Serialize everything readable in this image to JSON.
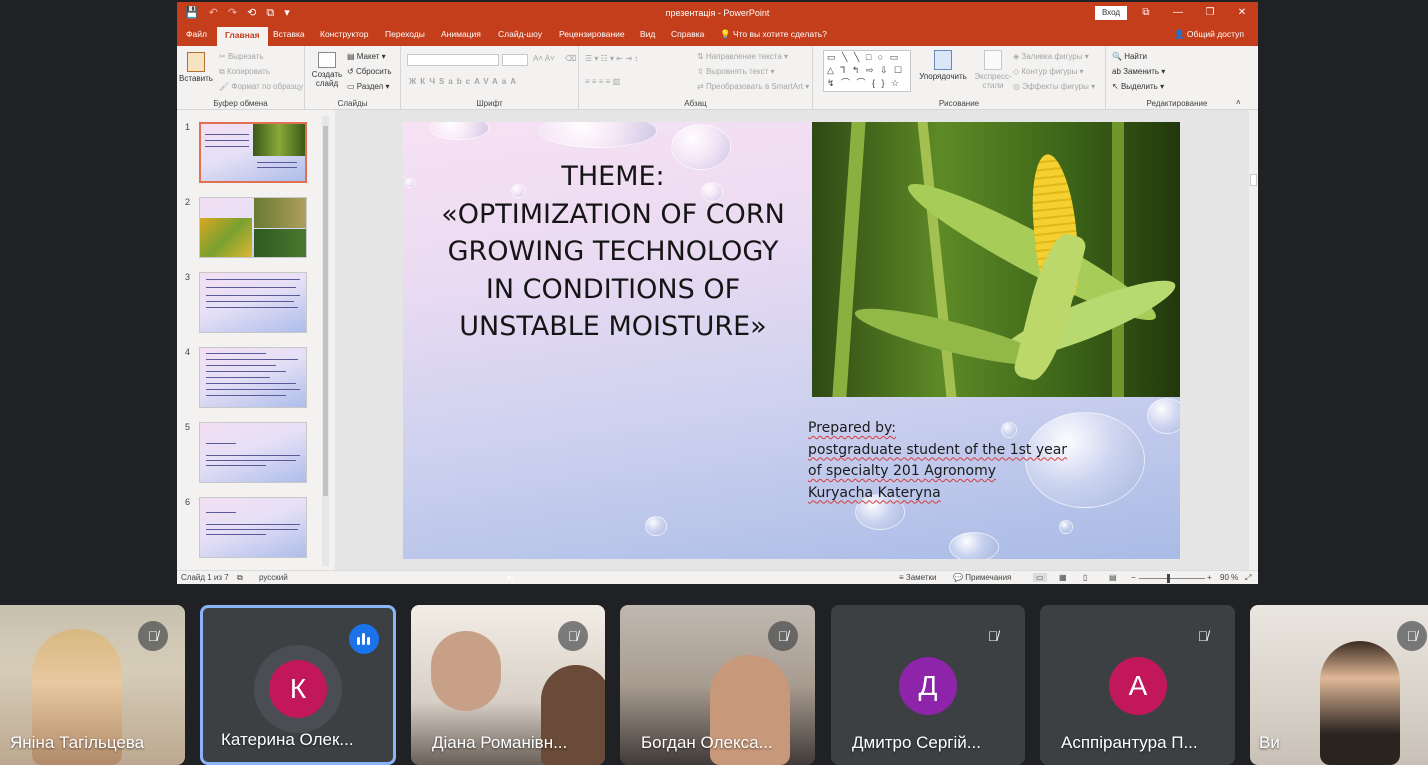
{
  "window": {
    "doc_title": "презентація - PowerPoint",
    "login_label": "Вход",
    "share_label": "Общий доступ",
    "tell_me": "Что вы хотите сделать?",
    "quick_access": [
      "💾",
      "↶",
      "↷",
      "⟲",
      "⧉",
      "▾"
    ],
    "win_controls": [
      "⧉",
      "—",
      "❐",
      "✕"
    ]
  },
  "tabs": [
    "Файл",
    "Главная",
    "Вставка",
    "Конструктор",
    "Переходы",
    "Анимация",
    "Слайд-шоу",
    "Рецензирование",
    "Вид",
    "Справка"
  ],
  "ribbon": {
    "clipboard": {
      "label": "Буфер обмена",
      "paste": "Вставить",
      "cut": "Вырезать",
      "copy": "Копировать",
      "format_painter": "Формат по образцу"
    },
    "slides": {
      "label": "Слайды",
      "new_slide": "Создать слайд",
      "layout": "Макет",
      "reset": "Сбросить",
      "section": "Раздел"
    },
    "font": {
      "label": "Шрифт",
      "buttons": [
        "Ж",
        "К",
        "Ч",
        "S",
        "abc",
        "AV",
        "Aa",
        "A"
      ]
    },
    "paragraph": {
      "label": "Абзац",
      "text_direction": "Направление текста",
      "align_text": "Выровнять текст",
      "smartart": "Преобразовать в SmartArt"
    },
    "drawing": {
      "label": "Рисование",
      "arrange": "Упорядочить",
      "quick_styles": "Экспресс-стили",
      "shape_fill": "Заливка фигуры",
      "shape_outline": "Контур фигуры",
      "shape_effects": "Эффекты фигуры",
      "shapes_row1": "▭ ╲ ╲ □ ○ ▭",
      "shapes_row2": "△ ⅂ ↰ ⇨ ⇩ ☐",
      "shapes_row3": "↯ ⌒ ⌒ { } ☆"
    },
    "editing": {
      "label": "Редактирование",
      "find": "Найти",
      "replace": "Заменить",
      "select": "Выделить"
    }
  },
  "thumbnails": [
    {
      "num": "1",
      "selected": true
    },
    {
      "num": "2"
    },
    {
      "num": "3"
    },
    {
      "num": "4"
    },
    {
      "num": "5"
    },
    {
      "num": "6"
    }
  ],
  "slide": {
    "title_lines": [
      "THEME:",
      "«OPTIMIZATION OF CORN",
      "GROWING TECHNOLOGY",
      "IN CONDITIONS OF",
      "UNSTABLE MOISTURE»"
    ],
    "prepared_lines": [
      "Prepared by:",
      "postgraduate student of the 1st year",
      "of specialty 201 Agronomy",
      "Kuryacha Kateryna"
    ]
  },
  "status": {
    "slide_counter": "Слайд 1 из 7",
    "language": "русский",
    "notes": "Заметки",
    "comments": "Примечания",
    "zoom": "90 %"
  },
  "participants": [
    {
      "name": "Яніна Тагільцева",
      "type": "video",
      "muted": true
    },
    {
      "name": "Катерина Олек...",
      "type": "avatar",
      "initial": "К",
      "color": "#c2185b",
      "speaking": true
    },
    {
      "name": "Діана Романівн...",
      "type": "video",
      "muted": true
    },
    {
      "name": "Богдан Олекса...",
      "type": "video",
      "muted": true
    },
    {
      "name": "Дмитро Сергій...",
      "type": "avatar",
      "initial": "Д",
      "color": "#8e24aa",
      "muted": true
    },
    {
      "name": "Асппірантура П...",
      "type": "avatar",
      "initial": "А",
      "color": "#c2185b",
      "muted": true
    },
    {
      "name": "Ви",
      "type": "video",
      "muted": true
    }
  ]
}
